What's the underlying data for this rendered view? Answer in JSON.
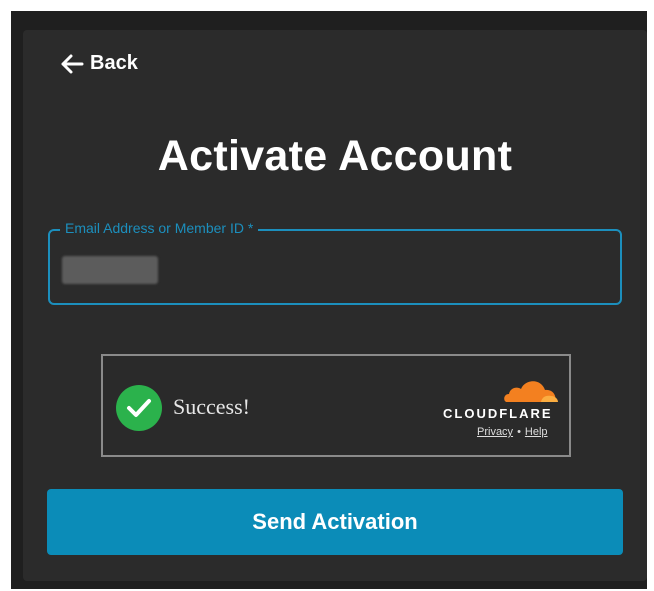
{
  "nav": {
    "back_label": "Back",
    "back_icon": "arrow-left-icon"
  },
  "page": {
    "title": "Activate Account"
  },
  "form": {
    "email_field": {
      "label": "Email Address or Member ID *",
      "value": "",
      "accent_color": "#1c8fbd"
    }
  },
  "captcha": {
    "status_text": "Success!",
    "status_icon": "check-circle-icon",
    "status_color": "#2bb24c",
    "brand": "CLOUDFLARE",
    "brand_icon": "cloudflare-cloud-icon",
    "brand_color": "#f38020",
    "privacy_label": "Privacy",
    "separator": "•",
    "help_label": "Help"
  },
  "actions": {
    "send_label": "Send Activation",
    "send_color": "#0b8cb8"
  }
}
